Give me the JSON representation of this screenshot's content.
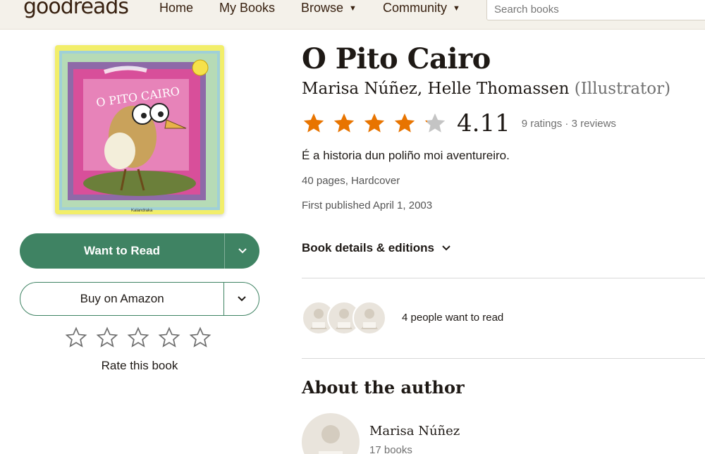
{
  "header": {
    "logo": "goodreads",
    "nav": {
      "home": "Home",
      "my_books": "My Books",
      "browse": "Browse",
      "community": "Community"
    },
    "search_placeholder": "Search books"
  },
  "book": {
    "title": "O Pito Cairo",
    "author": "Marisa Núñez",
    "illustrator": "Helle Thomassen",
    "illustrator_role": "(Illustrator)",
    "average_rating": "4.11",
    "rating_value": 4.11,
    "ratings_text": "9 ratings · 3 reviews",
    "description": "É a historia dun poliño moi aventureiro.",
    "pages_format": "40 pages, Hardcover",
    "first_published": "First published April 1, 2003",
    "cover_title": "O PITO CAIRO",
    "cover_publisher": "Kalandraka"
  },
  "actions": {
    "want_to_read": "Want to Read",
    "buy": "Buy on Amazon",
    "rate_label": "Rate this book",
    "details": "Book details & editions"
  },
  "social": {
    "want_count": "4 people want to read"
  },
  "about": {
    "heading": "About the author",
    "name": "Marisa Núñez",
    "books": "17 books"
  },
  "colors": {
    "header_bg": "#f4f1ea",
    "primary_green": "#3f8363",
    "star_orange": "#e87400",
    "star_empty": "#c4c4c4"
  }
}
